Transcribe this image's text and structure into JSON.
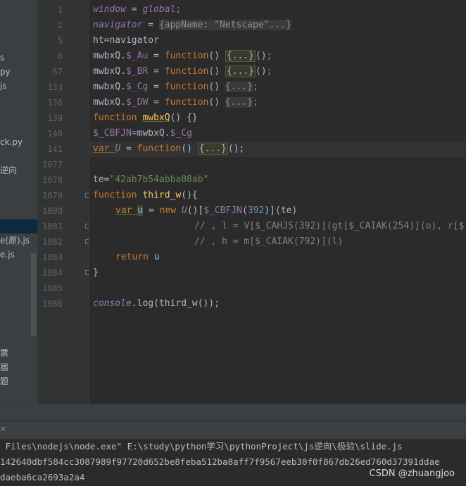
{
  "project_tree": {
    "items": [
      {
        "label": "s"
      },
      {
        "label": "py"
      },
      {
        "label": "js"
      },
      {
        "label": "ck.py"
      },
      {
        "label": "逆向"
      },
      {
        "label": "e(原).js"
      },
      {
        "label": "e.js"
      },
      {
        "label": "票"
      },
      {
        "label": "届"
      },
      {
        "label": "题"
      }
    ]
  },
  "editor": {
    "line_numbers": [
      "1",
      "2",
      "5",
      "6",
      "67",
      "133",
      "136",
      "139",
      "140",
      "141",
      "1077",
      "1078",
      "1079",
      "1080",
      "1081",
      "1082",
      "1083",
      "1084",
      "1085",
      "1086"
    ],
    "lines": {
      "l1_a": "window",
      "l1_b": " = ",
      "l1_c": "global",
      "l1_d": ";",
      "l2_a": "navigator",
      "l2_b": " = ",
      "l2_hint": "{appName: \"Netscape\"...}",
      "l5": "ht=navigator",
      "l6_a": "mwbxQ.",
      "l6_b": "$_Au",
      "l6_c": " = ",
      "l6_d": "function",
      "l6_e": "() ",
      "l6_f": "{...}",
      "l6_g": "()",
      "l6_h": ";",
      "l67_b": "$_BR",
      "l133_b": "$_Cg",
      "l136_b": "$_DW",
      "l139_a": "function ",
      "l139_b": "mwbxQ",
      "l139_c": "() {}",
      "l140_a": "$_CBFJN",
      "l140_b": "=mwbxQ.",
      "l140_c": "$_Cg",
      "l141_a": "var ",
      "l141_b": "U",
      "l141_c": " = ",
      "l141_d": "function",
      "l141_e": "() ",
      "l141_f": "{...}",
      "l141_g": "();",
      "l1078_a": "te=",
      "l1078_b": "\"42ab7b54abba08ab\"",
      "l1079_a": "function ",
      "l1079_b": "third_w",
      "l1079_c": "(){",
      "l1080_a": "var ",
      "l1080_b": "u",
      "l1080_c": " = ",
      "l1080_d": "new ",
      "l1080_e": "U",
      "l1080_f": "()[",
      "l1080_g": "$_CBFJN",
      "l1080_h": "(",
      "l1080_i": "392",
      "l1080_j": ")](te)",
      "l1081": "// , l = V[$_CAHJS(392)](gt[$_CAIAK(254)](o), r[$",
      "l1082": "// , h = m[$_CAIAK(792)](l)",
      "l1083_a": "return ",
      "l1083_b": "u",
      "l1084": "}",
      "l1086_a": "console",
      "l1086_b": ".log(third_w());"
    }
  },
  "run_panel": {
    "close_label": "×",
    "lines": [
      " Files\\nodejs\\node.exe\" E:\\study\\python学习\\pythonProject\\js逆向\\极验\\slide.js",
      "142640dbf584cc3087989f97720d652be8feba512ba8aff7f9567eeb30f0f867db26ed760d37391ddae",
      "daeba6ca2693a2a4"
    ]
  },
  "watermark": "CSDN @zhuangjoo"
}
